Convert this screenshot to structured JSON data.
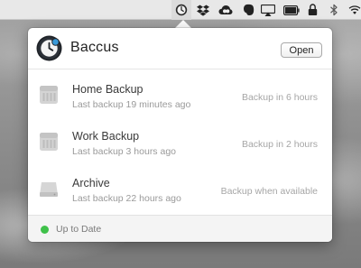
{
  "menubar": {
    "icons": [
      "baccus-clock-icon",
      "dropbox-icon",
      "creative-cloud-icon",
      "evernote-icon",
      "airplay-icon",
      "battery-icon",
      "lock-icon",
      "bluetooth-icon",
      "wifi-icon"
    ]
  },
  "app": {
    "name": "Baccus",
    "open_label": "Open"
  },
  "backups": [
    {
      "name": "Home Backup",
      "last": "Last backup 19 minutes ago",
      "next": "Backup in 6 hours",
      "icon": "network-drive-icon"
    },
    {
      "name": "Work Backup",
      "last": "Last backup 3 hours ago",
      "next": "Backup in 2 hours",
      "icon": "network-drive-icon"
    },
    {
      "name": "Archive",
      "last": "Last backup 22 hours ago",
      "next": "Backup when available",
      "icon": "external-drive-icon"
    }
  ],
  "status": {
    "text": "Up to Date",
    "color": "#3fc14a"
  },
  "colors": {
    "accent": "#3a9ad9"
  }
}
